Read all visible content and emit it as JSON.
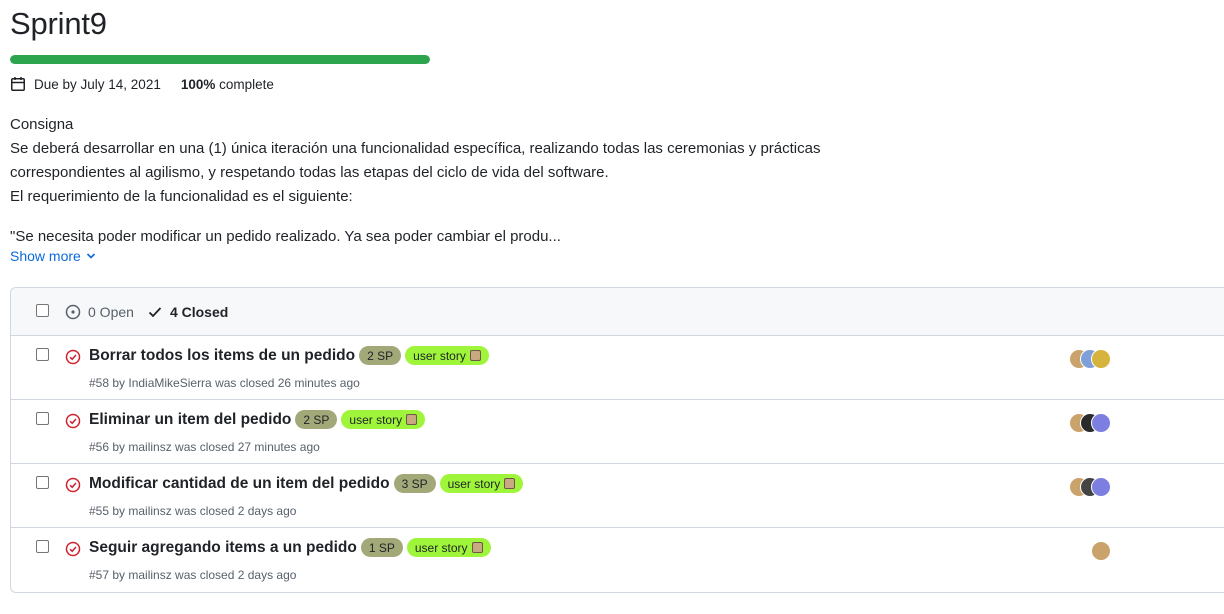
{
  "milestone": {
    "title": "Sprint9",
    "progress_percent": 100,
    "due_text": "Due by July 14, 2021",
    "complete_value": "100%",
    "complete_suffix": " complete"
  },
  "description": {
    "heading": "Consigna",
    "paragraph": "Se deberá desarrollar en una (1) única iteración una funcionalidad específica, realizando todas las ceremonias y prácticas correspondientes al agilismo, y respetando todas las etapas del ciclo de vida del software.",
    "requirement": "El requerimiento de la funcionalidad es el siguiente:",
    "quote": "\"Se necesita poder modificar un pedido realizado. Ya sea poder cambiar el produ...",
    "show_more": "Show more"
  },
  "issues_header": {
    "open_label": "0 Open",
    "closed_label": "4 Closed"
  },
  "colors": {
    "progress": "#2da44e",
    "sp_label": "#a3a878",
    "user_story_label": "#9ef53a",
    "closed_icon": "#cf222e",
    "link": "#0969da"
  },
  "issues": [
    {
      "title": "Borrar todos los items de un pedido",
      "sp": "2 SP",
      "label": "user story",
      "meta": "#58 by IndiaMikeSierra was closed 26 minutes ago",
      "avatars": [
        "#c9a36b",
        "#7f9fd9",
        "#d6b33c"
      ]
    },
    {
      "title": "Eliminar un item del pedido",
      "sp": "2 SP",
      "label": "user story",
      "meta": "#56 by mailinsz was closed 27 minutes ago",
      "avatars": [
        "#c9a36b",
        "#2b2b2b",
        "#7c7fe0"
      ]
    },
    {
      "title": "Modificar cantidad de un item del pedido",
      "sp": "3 SP",
      "label": "user story",
      "meta": "#55 by mailinsz was closed 2 days ago",
      "avatars": [
        "#c9a36b",
        "#444444",
        "#7c7fe0"
      ]
    },
    {
      "title": "Seguir agregando items a un pedido",
      "sp": "1 SP",
      "label": "user story",
      "meta": "#57 by mailinsz was closed 2 days ago",
      "avatars": [
        "#c9a36b"
      ]
    }
  ]
}
